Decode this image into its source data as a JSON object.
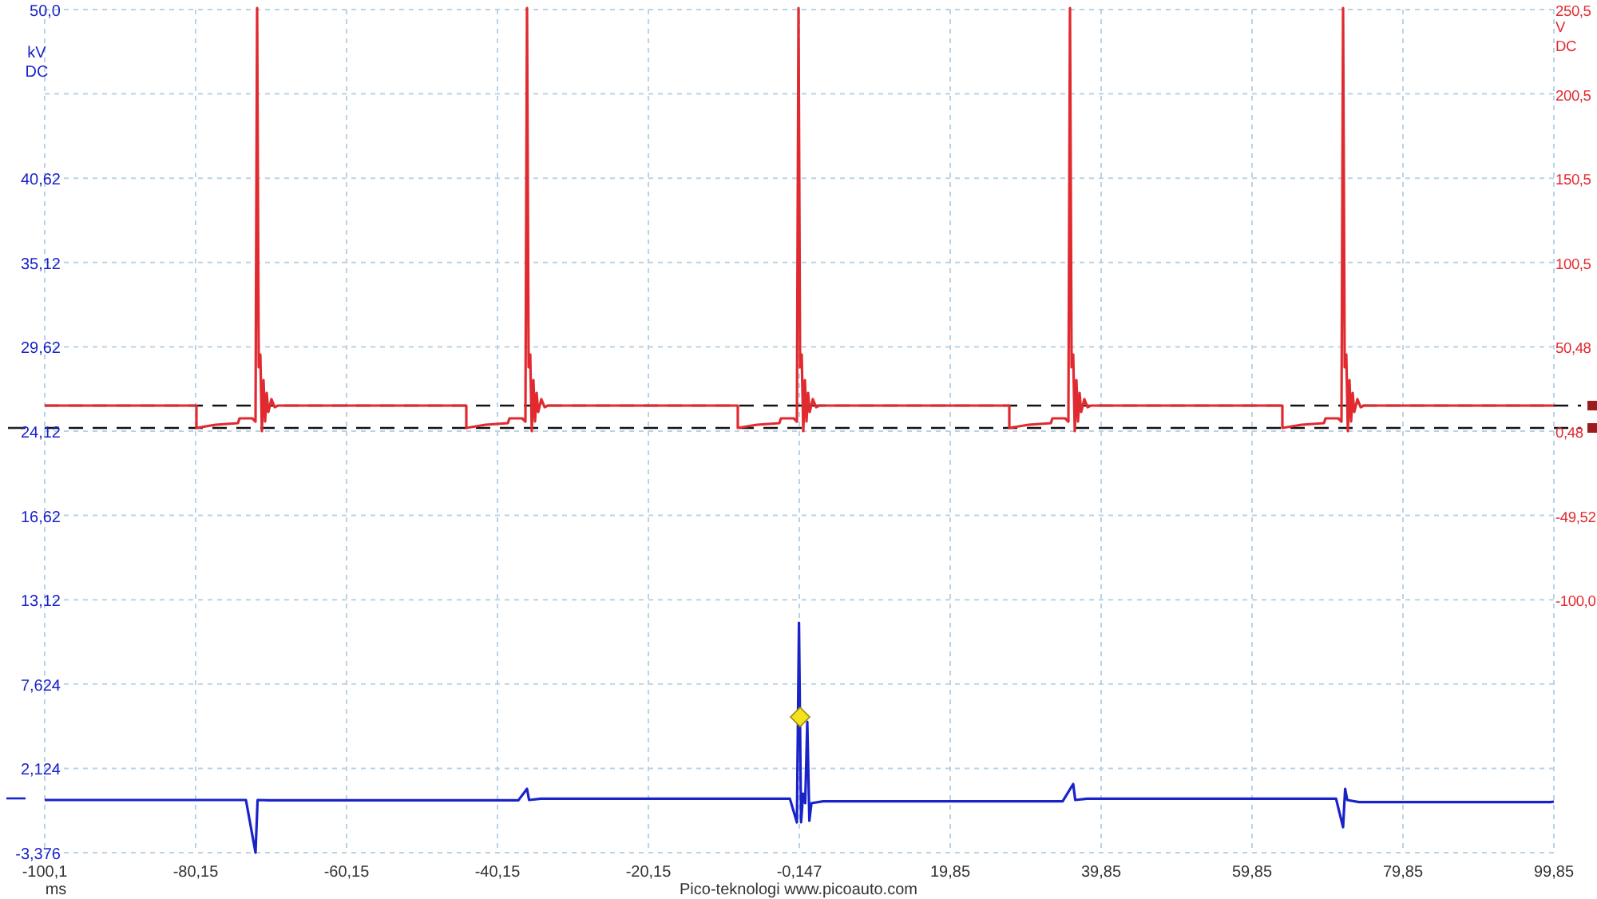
{
  "channels": [
    {
      "unit": "kV",
      "coupling": "DC",
      "color": "#1a23c8",
      "labels": [
        "50,0",
        "40,62",
        "35,12",
        "29,62",
        "24,12",
        "16,62",
        "13,12",
        "7,624",
        "2,124",
        "-3,376"
      ]
    },
    {
      "unit": "V",
      "coupling": "DC",
      "color": "#e02a2f",
      "labels": [
        "250,5",
        "200,5",
        "150,5",
        "100,5",
        "50,48",
        "0,48",
        "-49,52",
        "-100,0"
      ]
    }
  ],
  "x_axis": {
    "unit": "ms",
    "labels": [
      "-100,1",
      "-80,15",
      "-60,15",
      "-40,15",
      "-20,15",
      "-0,147",
      "19,85",
      "39,85",
      "59,85",
      "79,85",
      "99,85"
    ]
  },
  "footer": "Pico-teknologi  www.picoauto.com"
}
